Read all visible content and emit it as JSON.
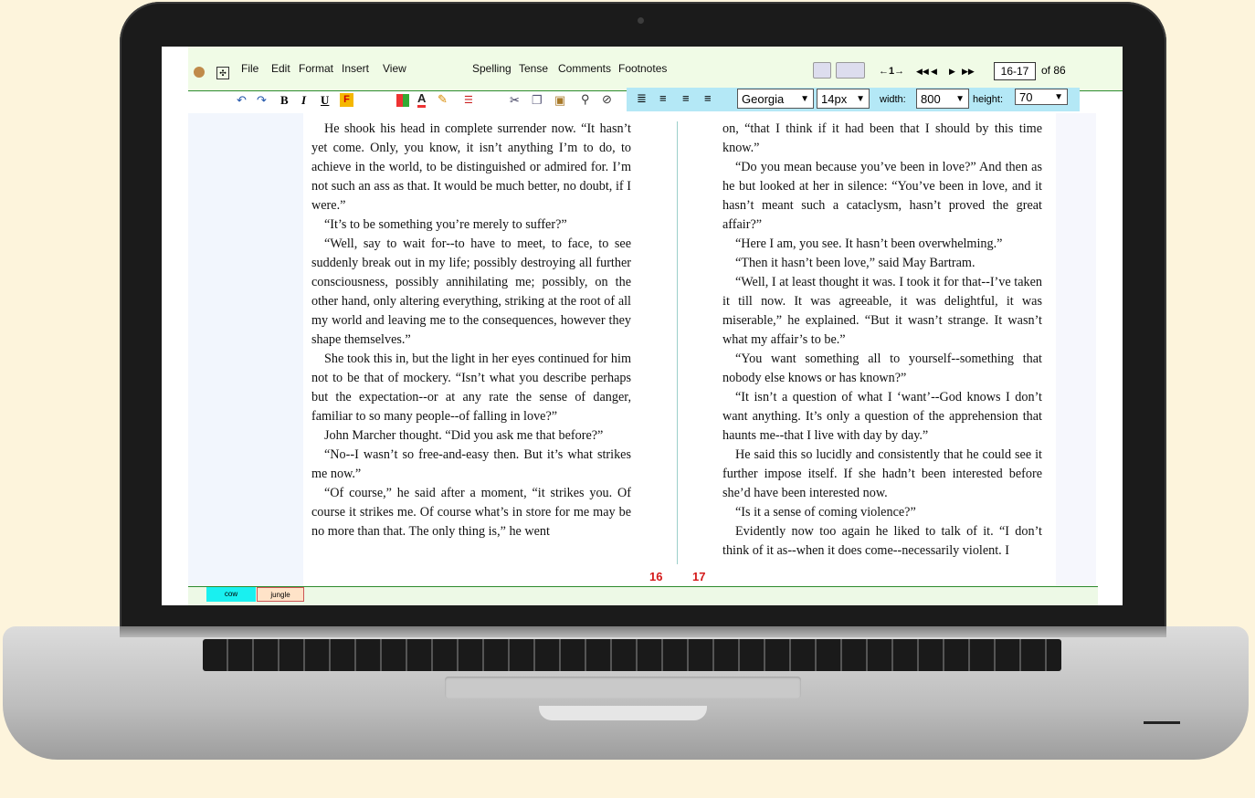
{
  "menu": [
    "File",
    "Edit",
    "Format",
    "Insert",
    "View"
  ],
  "tools_menu": [
    "Spelling",
    "Tense",
    "Comments",
    "Footnotes"
  ],
  "nav": {
    "arrow_label": "←1→",
    "page_range": "16-17",
    "of_label": "of",
    "total_pages": "86"
  },
  "format": {
    "font": "Georgia",
    "size": "14px",
    "width_label": "width:",
    "width_value": "800",
    "height_label": "height:",
    "height_value": "70"
  },
  "left_page": {
    "number": "16",
    "paragraphs": [
      "He shook his head in complete surrender now. “It hasn’t yet come. Only, you know, it isn’t anything I’m to do, to achieve in the world, to be distinguished or admired for. I’m not such an ass as that. It would be much better, no doubt, if I were.”",
      "“It’s to be something you’re merely to suffer?”",
      "“Well, say to wait for--to have to meet, to face, to see suddenly break out in my life; possibly destroying all further consciousness, possibly annihilating me; possibly, on the other hand, only altering everything, striking at the root of all my world and leaving me to the consequences, however they shape themselves.”",
      "She took this in, but the light in her eyes continued for him not to be that of mockery. “Isn’t what you describe perhaps but the expectation--or at any rate the sense of danger, familiar to so many people--of falling in love?”",
      "John Marcher thought. “Did you ask me that before?”",
      "“No--I wasn’t so free-and-easy then. But it’s what strikes me now.”",
      "“Of course,” he said after a moment, “it strikes you. Of course it strikes me. Of course what’s in store for me may be no more than that. The only thing is,” he went"
    ]
  },
  "right_page": {
    "number": "17",
    "paragraphs": [
      "on, “that I think if it had been that I should by this time know.”",
      "“Do you mean because you’ve been in love?” And then as he but looked at her in silence: “You’ve been in love, and it hasn’t meant such a cataclysm, hasn’t proved the great affair?”",
      "“Here I am, you see. It hasn’t been overwhelming.”",
      "“Then it hasn’t been love,” said May Bartram.",
      "“Well, I at least thought it was. I took it for that--I’ve taken it till now. It was agreeable, it was delightful, it was miserable,” he explained. “But it wasn’t strange. It wasn’t what my affair’s to be.”",
      "“You want something all to yourself--something that nobody else knows or has known?”",
      "“It isn’t a question of what I ‘want’--God knows I don’t want anything. It’s only a question of the apprehension that haunts me--that I live with day by day.”",
      "He said this so lucidly and consistently that he could see it further impose itself. If she hadn’t been interested before she’d have been interested now.",
      "“Is it a sense of coming violence?”",
      "Evidently now too again he liked to talk of it. “I don’t think of it as--when it does come--necessarily violent. I"
    ]
  },
  "tabs": [
    "cow",
    "jungle"
  ],
  "colors": {
    "menubar": "#f0fbe6",
    "accent_line": "#2e8b2e",
    "page_number": "#d41a1a",
    "format_band": "#b4e8f6",
    "tab_cow": "#19f0f0",
    "tab_jungle": "#ffe3c8"
  }
}
